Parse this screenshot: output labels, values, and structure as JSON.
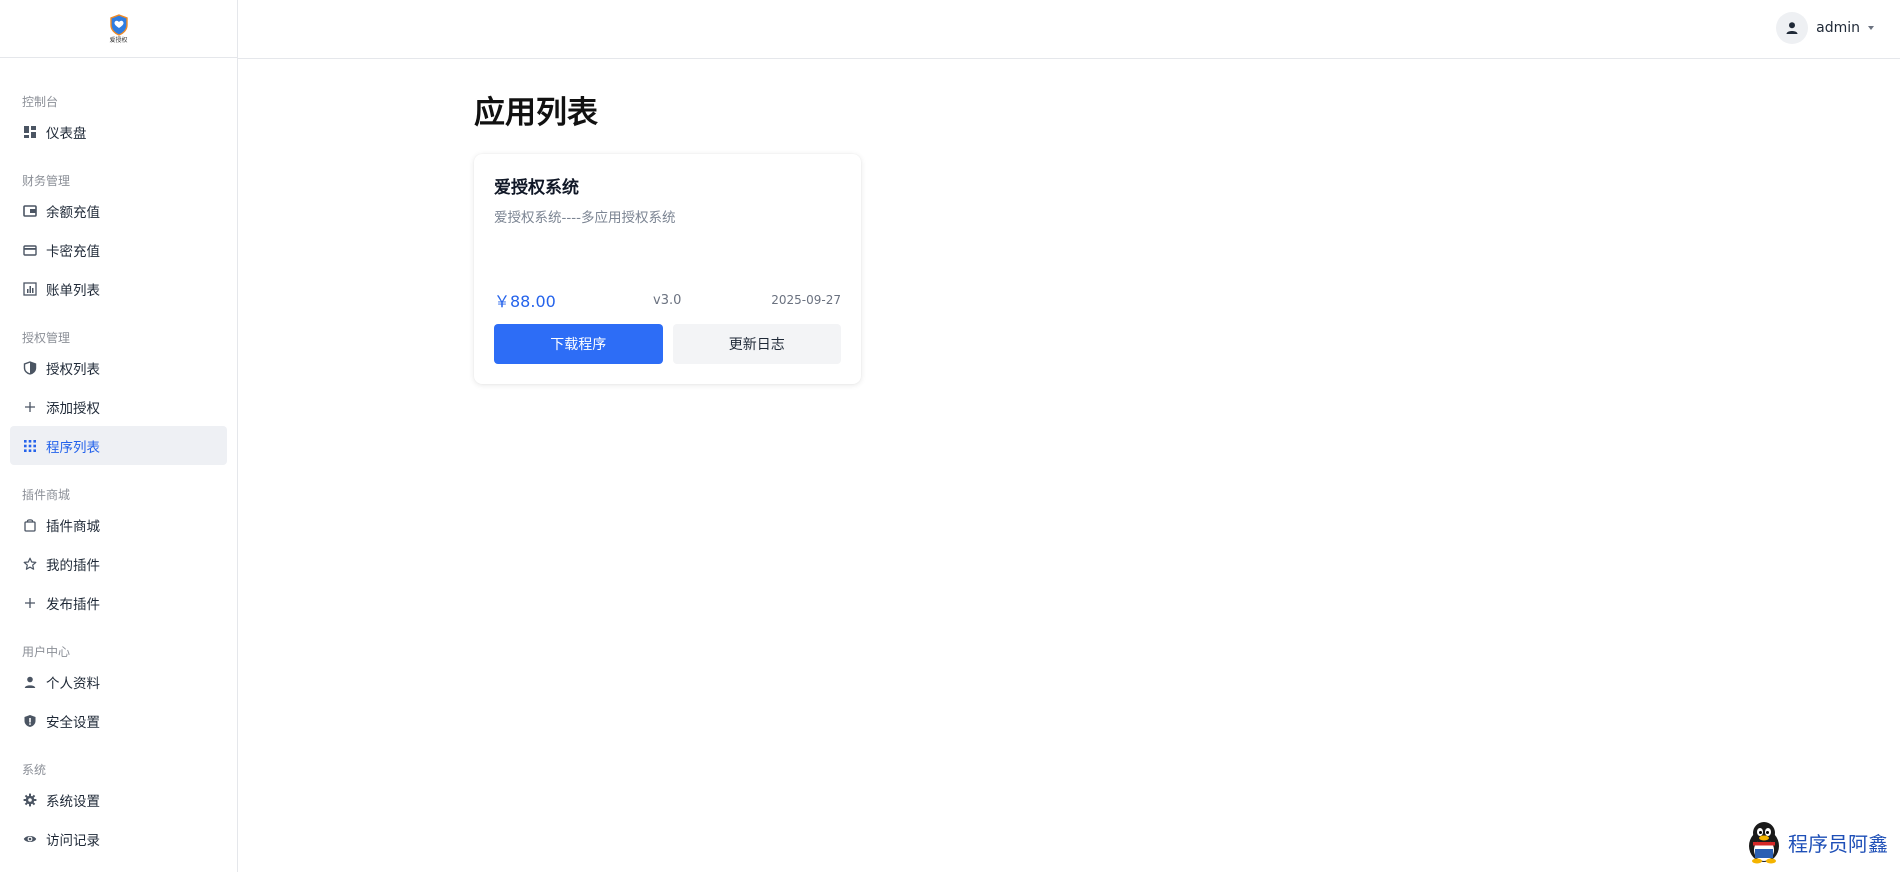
{
  "logo": {
    "text": "爱授权"
  },
  "sidebar": {
    "groups": [
      {
        "title": "控制台",
        "items": [
          {
            "label": "仪表盘",
            "icon": "dashboard-icon"
          }
        ]
      },
      {
        "title": "财务管理",
        "items": [
          {
            "label": "余额充值",
            "icon": "wallet-icon"
          },
          {
            "label": "卡密充值",
            "icon": "credit-card-icon"
          },
          {
            "label": "账单列表",
            "icon": "bar-chart-icon"
          }
        ]
      },
      {
        "title": "授权管理",
        "items": [
          {
            "label": "授权列表",
            "icon": "shield-icon"
          },
          {
            "label": "添加授权",
            "icon": "plus-icon"
          },
          {
            "label": "程序列表",
            "icon": "grid-icon",
            "active": true
          }
        ]
      },
      {
        "title": "插件商城",
        "items": [
          {
            "label": "插件商城",
            "icon": "shopping-bag-icon"
          },
          {
            "label": "我的插件",
            "icon": "star-icon"
          },
          {
            "label": "发布插件",
            "icon": "plus-icon"
          }
        ]
      },
      {
        "title": "用户中心",
        "items": [
          {
            "label": "个人资料",
            "icon": "user-icon"
          },
          {
            "label": "安全设置",
            "icon": "shield-check-icon"
          }
        ]
      },
      {
        "title": "系统",
        "items": [
          {
            "label": "系统设置",
            "icon": "gear-icon"
          },
          {
            "label": "访问记录",
            "icon": "eye-icon"
          }
        ]
      }
    ]
  },
  "header": {
    "username": "admin"
  },
  "main": {
    "title": "应用列表",
    "card": {
      "title": "爱授权系统",
      "description": "爱授权系统----多应用授权系统",
      "price": "￥88.00",
      "version": "v3.0",
      "date": "2025-09-27",
      "download_label": "下载程序",
      "changelog_label": "更新日志"
    }
  },
  "watermark": {
    "text": "程序员阿鑫"
  },
  "colors": {
    "accent": "#2d6df6",
    "active_bg": "#eef0f4",
    "price": "#2563eb"
  }
}
